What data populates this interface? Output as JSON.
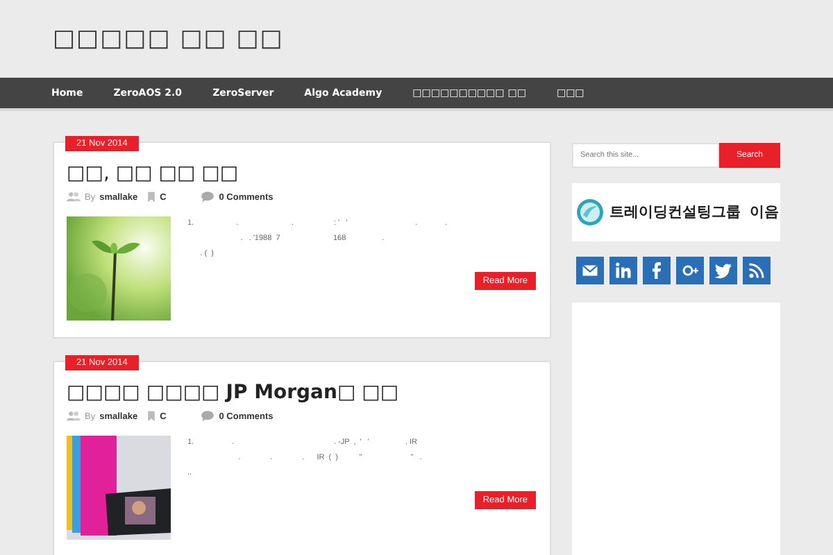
{
  "site_title": "□□□□□ □□ □□",
  "nav": [
    {
      "label": "Home"
    },
    {
      "label": "ZeroAOS 2.0"
    },
    {
      "label": "ZeroServer"
    },
    {
      "label": "Algo Academy"
    },
    {
      "label": "□□□□□□□□□□ □□"
    },
    {
      "label": "□□□"
    }
  ],
  "posts": [
    {
      "date": "21 Nov 2014",
      "title": "□□, □□ □□ □□",
      "by": "By",
      "author": "smallake",
      "category": "C",
      "comments": "0 Comments",
      "excerpt": "1.                    .                         .                   : '   '                                .             .\n                         .   . '1988  7                         168                 .\n      . (  )",
      "button": "Read More"
    },
    {
      "date": "21 Nov 2014",
      "title": "□□□□ □□□□ **JP Morgan**□ □□",
      "by": "By",
      "author": "smallake",
      "category": "C",
      "comments": "0 Comments",
      "excerpt": "1.                  .                                               . -JP  ,  '   '                 . IR\n                        .              .              .      IR  (  )          \"                       \"   .\n..",
      "button": "Read More"
    }
  ],
  "sidebar": {
    "search": {
      "placeholder": "Search this site...",
      "button": "Search"
    },
    "banner": "트레이딩컨설팅그룹  이음"
  }
}
